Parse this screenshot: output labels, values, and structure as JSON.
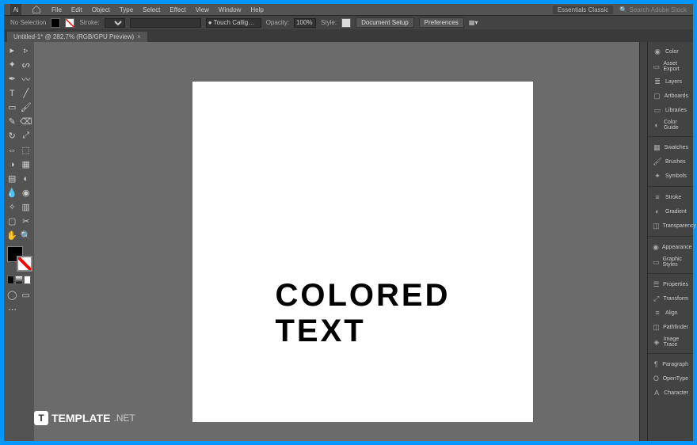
{
  "menu": {
    "items": [
      "File",
      "Edit",
      "Object",
      "Type",
      "Select",
      "Effect",
      "View",
      "Window",
      "Help"
    ],
    "workspace": "Essentials Classic",
    "search": "Search Adobe Stock"
  },
  "control": {
    "selstate": "No Selection",
    "stroke_lbl": "Stroke:",
    "brush": "Touch Callig…",
    "opacity_lbl": "Opacity:",
    "opacity": "100%",
    "style_lbl": "Style:",
    "docsetup": "Document Setup",
    "prefs": "Preferences"
  },
  "tab": {
    "title": "Untitled-1* @ 282.7% (RGB/GPU Preview)"
  },
  "canvas": {
    "text": "COLORED TEXT"
  },
  "panels": {
    "g1": [
      "Color",
      "Asset Export",
      "Layers",
      "Artboards",
      "Libraries",
      "Color Guide"
    ],
    "g2": [
      "Swatches",
      "Brushes",
      "Symbols"
    ],
    "g3": [
      "Stroke",
      "Gradient",
      "Transparency"
    ],
    "g4": [
      "Appearance",
      "Graphic Styles"
    ],
    "g5": [
      "Properties",
      "Transform",
      "Align",
      "Pathfinder",
      "Image Trace"
    ],
    "g6": [
      "Paragraph",
      "OpenType",
      "Character"
    ]
  },
  "watermark": {
    "brand": "TEMPLATE",
    "suffix": ".NET",
    "icon": "T"
  }
}
